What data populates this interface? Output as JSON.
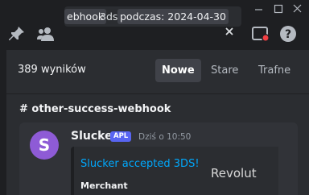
{
  "search": {
    "chips": [
      "ebhook",
      "3ds",
      "podczas: 2024-04-30"
    ]
  },
  "results": {
    "count_label": "389 wyników",
    "sort_options": [
      "Nowe",
      "Stare",
      "Trafne"
    ],
    "active_sort": "Nowe"
  },
  "channel": {
    "name": "# other-success-webhook"
  },
  "message": {
    "avatar_letter": "S",
    "author": "Slucker",
    "badge": "APL",
    "timestamp": "Dziś o 10:50",
    "embed": {
      "title": "Slucker accepted 3DS!",
      "field_label": "Merchant",
      "thumbnail_text": "Revolut"
    }
  },
  "colors": {
    "accent_link": "#00a8fc",
    "badge_bg": "#5865f2",
    "avatar_bg": "#8e5bd6"
  },
  "icons": [
    "minimize-icon",
    "maximize-icon",
    "close-window-icon",
    "pin-icon",
    "members-icon",
    "clear-icon",
    "inbox-icon",
    "help-icon"
  ]
}
